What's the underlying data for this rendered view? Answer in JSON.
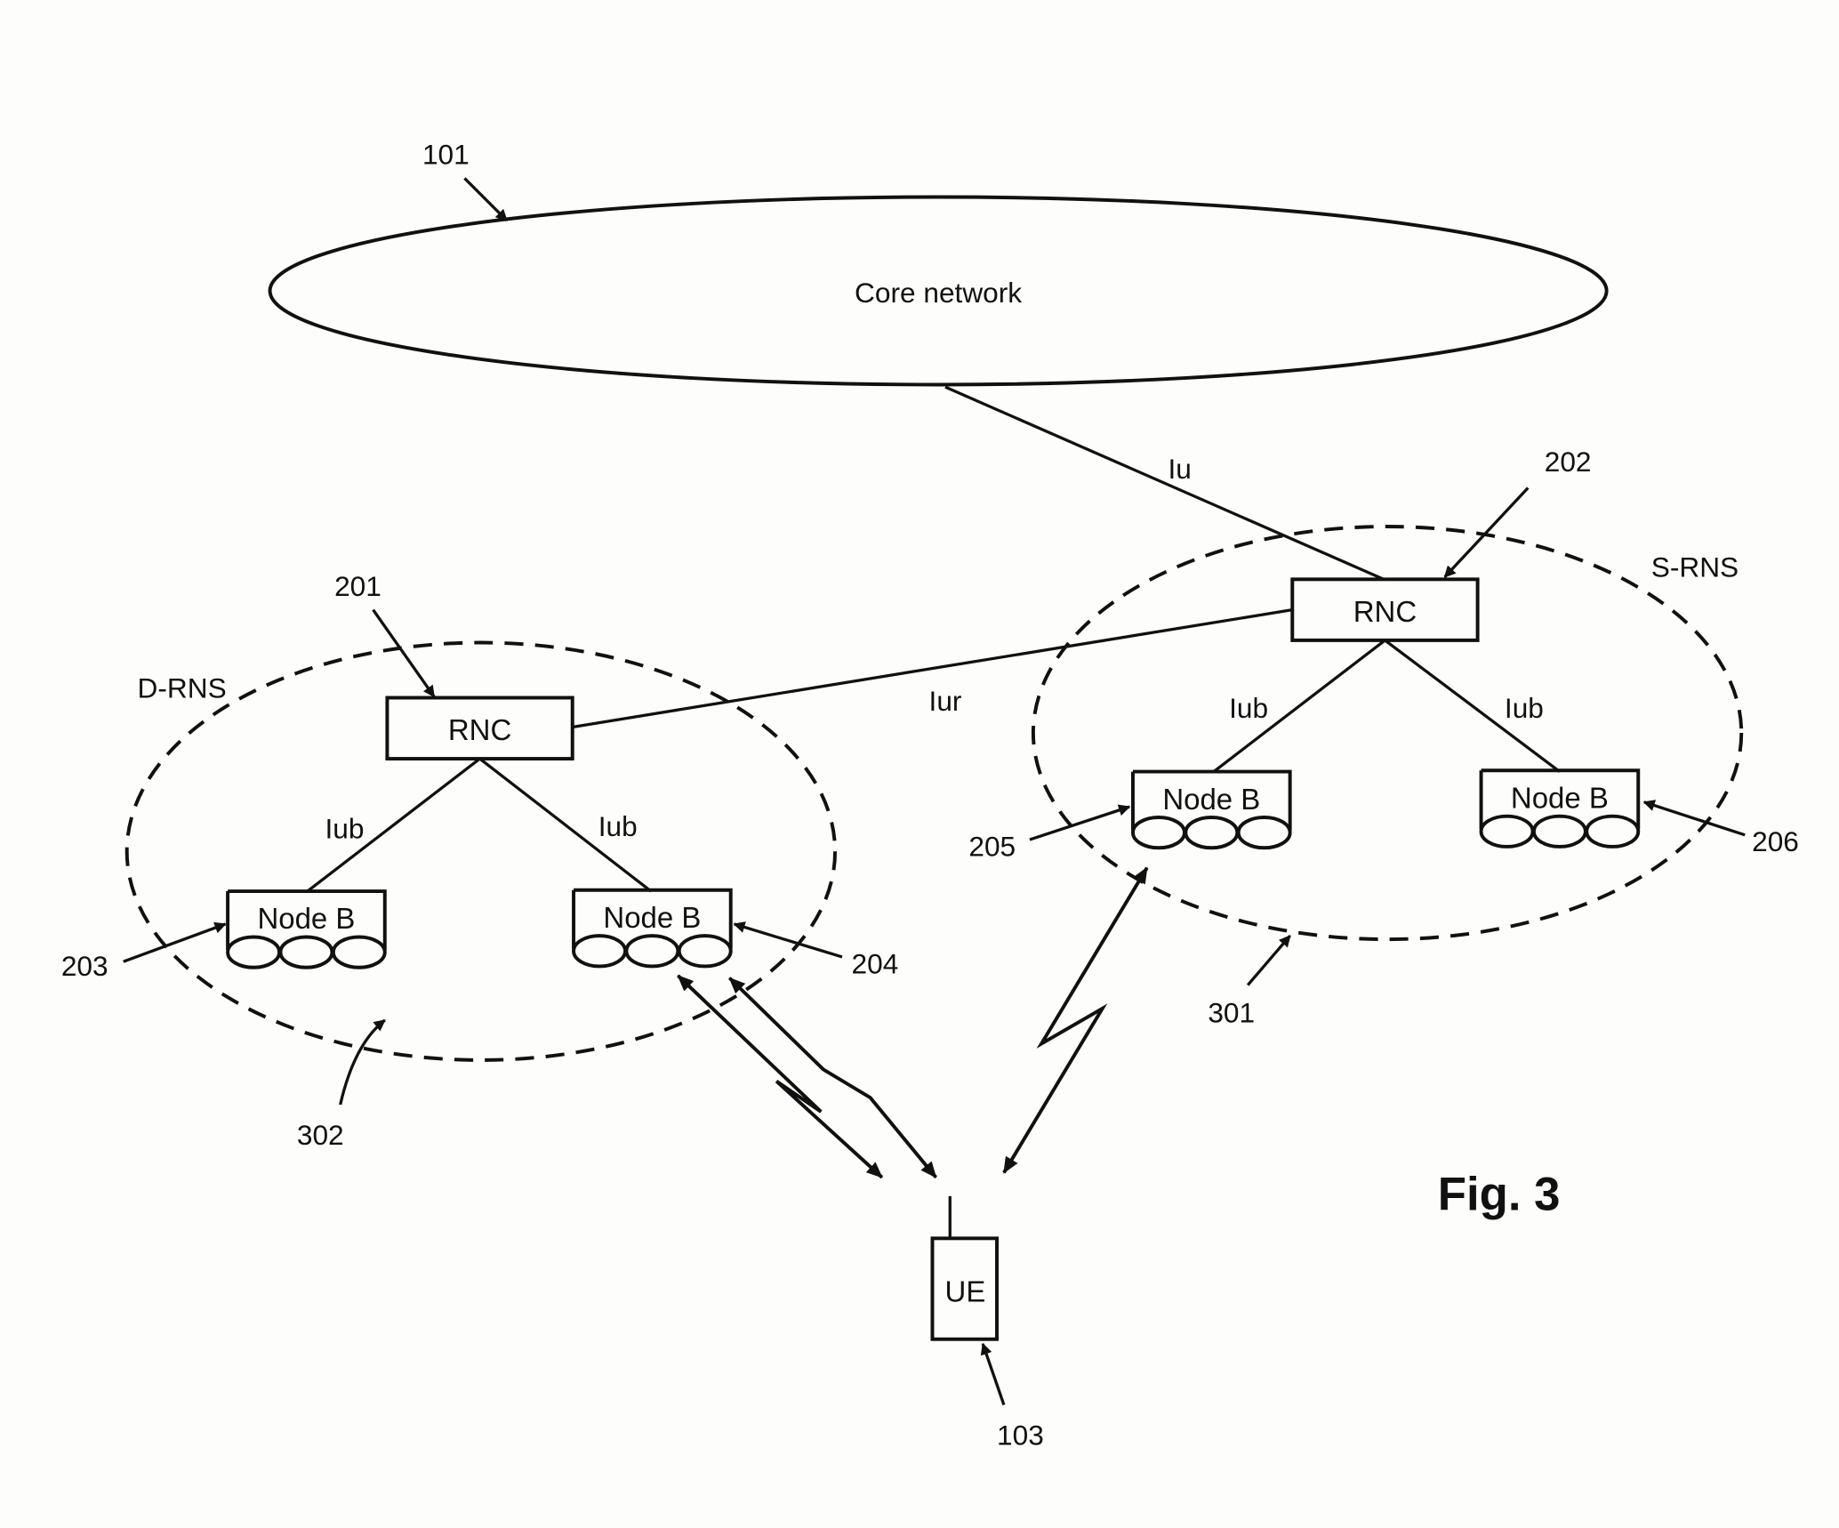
{
  "figure": {
    "caption": "Fig. 3",
    "core_network": {
      "label": "Core network",
      "ref": "101"
    },
    "ue": {
      "label": "UE",
      "ref": "103"
    },
    "rnc_drift": {
      "label": "RNC",
      "ref": "201",
      "domain_label": "D-RNS",
      "domain_ref": "302"
    },
    "rnc_serving": {
      "label": "RNC",
      "ref": "202",
      "domain_label": "S-RNS",
      "domain_ref": "301"
    },
    "node_b_203": {
      "label": "Node B",
      "ref": "203"
    },
    "node_b_204": {
      "label": "Node B",
      "ref": "204"
    },
    "node_b_205": {
      "label": "Node B",
      "ref": "205"
    },
    "node_b_206": {
      "label": "Node B",
      "ref": "206"
    },
    "interfaces": {
      "iu": "Iu",
      "iur": "Iur",
      "iub_d_left": "Iub",
      "iub_d_right": "Iub",
      "iub_s_left": "Iub",
      "iub_s_right": "Iub"
    }
  }
}
